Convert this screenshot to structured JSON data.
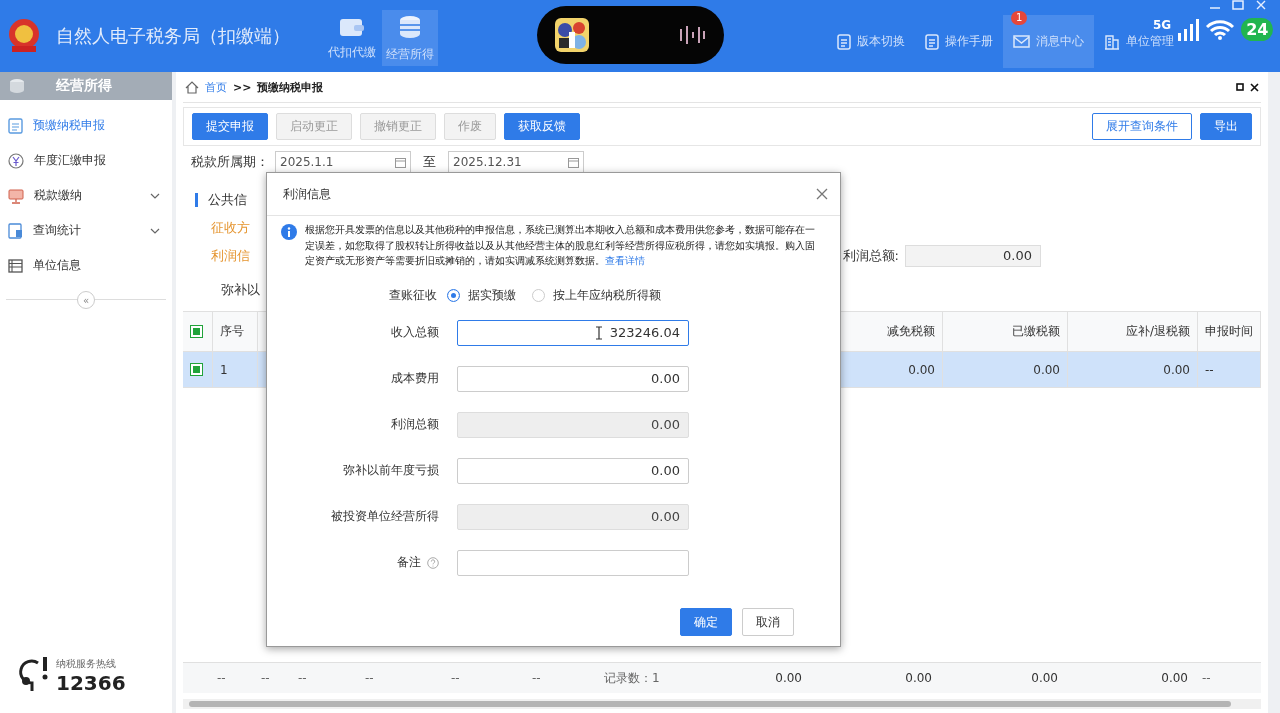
{
  "header": {
    "title": "自然人电子税务局（扣缴端）",
    "nav": [
      {
        "label": "代扣代缴",
        "kind": "wallet",
        "selected": false
      },
      {
        "label": "经营所得",
        "kind": "coins",
        "selected": true
      }
    ],
    "links": [
      {
        "label": "版本切换",
        "kind": "doc",
        "highlighted": false
      },
      {
        "label": "操作手册",
        "kind": "doc",
        "highlighted": false
      },
      {
        "label": "消息中心",
        "kind": "mail",
        "badge": "1",
        "highlighted": true
      },
      {
        "label": "单位管理",
        "kind": "building",
        "highlighted": false
      }
    ]
  },
  "status_overlay": {
    "network": "5G",
    "battery": "24"
  },
  "sidebar": {
    "title": "经营所得",
    "items": [
      {
        "label": "预缴纳税申报",
        "kind": "clipboard",
        "selected": true
      },
      {
        "label": "年度汇缴申报",
        "kind": "yen",
        "selected": false
      },
      {
        "label": "税款缴纳",
        "kind": "monitor",
        "selected": false,
        "expanded": false
      },
      {
        "label": "查询统计",
        "kind": "chart",
        "selected": false,
        "expanded": false
      },
      {
        "label": "单位信息",
        "kind": "list",
        "selected": false
      }
    ],
    "collapse": "«"
  },
  "hotline": {
    "caption": "纳税服务热线",
    "number": "12366"
  },
  "breadcrumb": {
    "home": "首页",
    "separator": ">>",
    "current": "预缴纳税申报"
  },
  "toolbar": {
    "buttons": [
      {
        "label": "提交申报",
        "kind": "primary"
      },
      {
        "label": "启动更正",
        "kind": "disabled"
      },
      {
        "label": "撤销更正",
        "kind": "disabled"
      },
      {
        "label": "作废",
        "kind": "disabled"
      },
      {
        "label": "获取反馈",
        "kind": "primary"
      }
    ],
    "right_buttons": [
      {
        "label": "展开查询条件",
        "kind": "outline"
      },
      {
        "label": "导出",
        "kind": "primary"
      }
    ]
  },
  "filters": {
    "period_label": "税款所属期：",
    "from": "2025.1.1",
    "to_label": "至",
    "to": "2025.12.31"
  },
  "form": {
    "section_title": "公共信",
    "collection_label": "征收方",
    "profit_label": "利润信",
    "loss_label": "弥补以",
    "profit_total": {
      "label": "利润总额:",
      "value": "0.00"
    }
  },
  "table": {
    "header_checked": true,
    "columns": [
      "序号",
      "减免税额",
      "已缴税额",
      "应补/退税额",
      "申报时间"
    ],
    "rows": [
      {
        "selected": true,
        "checked": true,
        "cells": [
          "1",
          "0.00",
          "0.00",
          "0.00",
          "--"
        ]
      }
    ],
    "footer": [
      "--",
      "--",
      "--",
      "--",
      "--",
      "--",
      "记录数：1",
      "0.00",
      "0.00",
      "0.00",
      "0.00",
      "--"
    ]
  },
  "dialog": {
    "title": "利润信息",
    "notice": "根据您开具发票的信息以及其他税种的申报信息，系统已测算出本期收入总额和成本费用供您参考，数据可能存在一定误差，如您取得了股权转让所得收益以及从其他经营主体的股息红利等经营所得应税所得，请您如实填报。购入固定资产或无形资产等需要折旧或摊销的，请如实调减系统测算数据。",
    "notice_link": "查看详情",
    "method_label": "查账征收",
    "options": [
      {
        "label": "据实预缴",
        "selected": true
      },
      {
        "label": "按上年应纳税所得额",
        "selected": false
      }
    ],
    "fields": [
      {
        "label": "收入总额",
        "value": "323246.04",
        "focused": true,
        "disabled": false
      },
      {
        "label": "成本费用",
        "value": "0.00",
        "focused": false,
        "disabled": false
      },
      {
        "label": "利润总额",
        "value": "0.00",
        "focused": false,
        "disabled": true
      },
      {
        "label": "弥补以前年度亏损",
        "value": "0.00",
        "focused": false,
        "disabled": false
      },
      {
        "label": "被投资单位经营所得",
        "value": "0.00",
        "focused": false,
        "disabled": true
      },
      {
        "label": "备注",
        "help": true,
        "focused": false,
        "disabled": false
      }
    ],
    "buttons": [
      {
        "label": "确定",
        "kind": "primary"
      },
      {
        "label": "取消",
        "kind": "default"
      }
    ]
  }
}
